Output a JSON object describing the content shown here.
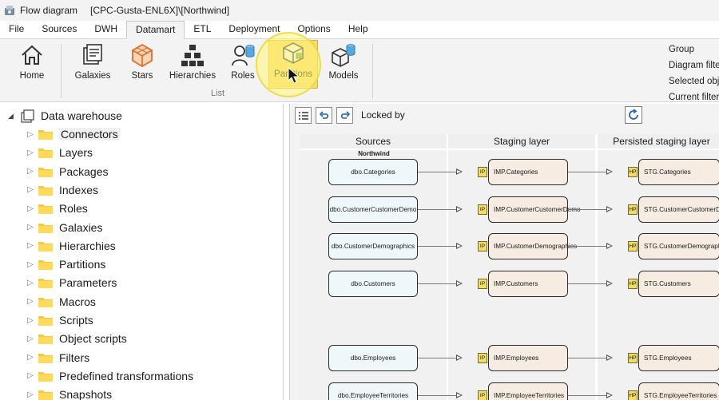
{
  "window": {
    "app_title": "Flow diagram",
    "context": "[CPC-Gusta-ENL6X]\\[Northwind]"
  },
  "menu": {
    "tabs": [
      "File",
      "Sources",
      "DWH",
      "Datamart",
      "ETL",
      "Deployment",
      "Options",
      "Help"
    ],
    "active": "Datamart"
  },
  "ribbon": {
    "buttons": [
      {
        "label": "Home",
        "icon": "home-icon"
      },
      {
        "label": "Galaxies",
        "icon": "galaxies-icon"
      },
      {
        "label": "Stars",
        "icon": "stars-icon"
      },
      {
        "label": "Hierarchies",
        "icon": "hierarchies-icon"
      },
      {
        "label": "Roles",
        "icon": "roles-icon"
      },
      {
        "label": "Partitions",
        "icon": "partitions-icon"
      },
      {
        "label": "Models",
        "icon": "models-icon"
      }
    ],
    "group_label": "List",
    "right_labels": [
      "Group",
      "Diagram filte",
      "Selected obj",
      "Current filter"
    ]
  },
  "tree": {
    "root": "Data warehouse",
    "items": [
      "Connectors",
      "Layers",
      "Packages",
      "Indexes",
      "Roles",
      "Galaxies",
      "Hierarchies",
      "Partitions",
      "Parameters",
      "Macros",
      "Scripts",
      "Object scripts",
      "Filters",
      "Predefined transformations",
      "Snapshots"
    ],
    "selected": "Connectors"
  },
  "toolbar": {
    "locked_label": "Locked by",
    "locked_value": ""
  },
  "diagram": {
    "columns": [
      "Sources",
      "Staging layer",
      "Persisted staging layer"
    ],
    "group": "Northwind",
    "staging_tag": "IP",
    "persisted_tag": "HP",
    "rows": [
      {
        "source": "dbo.Categories",
        "staging": "IMP.Categories",
        "persisted": "STG.Categories"
      },
      {
        "source": "dbo.CustomerCustomerDemo",
        "staging": "IMP.CustomerCustomerDemo",
        "persisted": "STG.CustomerCustomerDemo"
      },
      {
        "source": "dbo.CustomerDemographics",
        "staging": "IMP.CustomerDemographics",
        "persisted": "STG.CustomerDemographics"
      },
      {
        "source": "dbo.Customers",
        "staging": "IMP.Customers",
        "persisted": "STG.Customers"
      },
      {
        "source": "dbo.Employees",
        "staging": "IMP.Employees",
        "persisted": "STG.Employees"
      },
      {
        "source": "dbo.EmployeeTerritories",
        "staging": "IMP.EmployeeTerritories",
        "persisted": "STG.EmployeeTerritories"
      }
    ]
  }
}
